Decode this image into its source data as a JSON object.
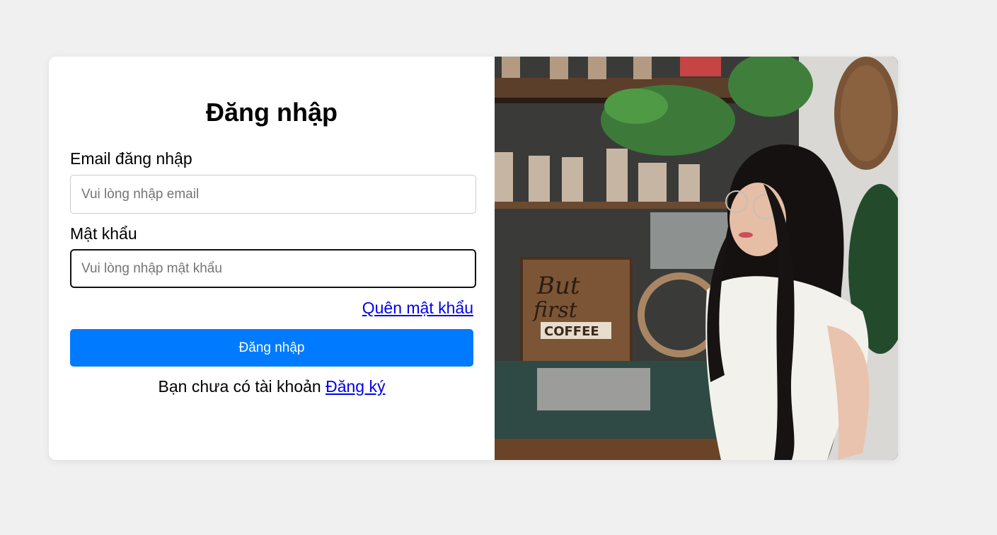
{
  "login": {
    "title": "Đăng nhập",
    "email_label": "Email đăng nhập",
    "email_placeholder": "Vui lòng nhập email",
    "email_value": "",
    "password_label": "Mật khẩu",
    "password_placeholder": "Vui lòng nhập mật khẩu",
    "password_value": "",
    "forgot_link": "Quên mật khẩu",
    "submit_label": "Đăng nhập",
    "no_account_text": "Bạn chưa có tài khoản",
    "register_link": "Đăng ký"
  },
  "photo": {
    "sign_lines": [
      "But",
      "first",
      "COFFEE"
    ],
    "icon": "portrait-photo"
  },
  "colors": {
    "accent": "#007bff",
    "link": "#0000ee",
    "background": "#f0f0f0"
  }
}
